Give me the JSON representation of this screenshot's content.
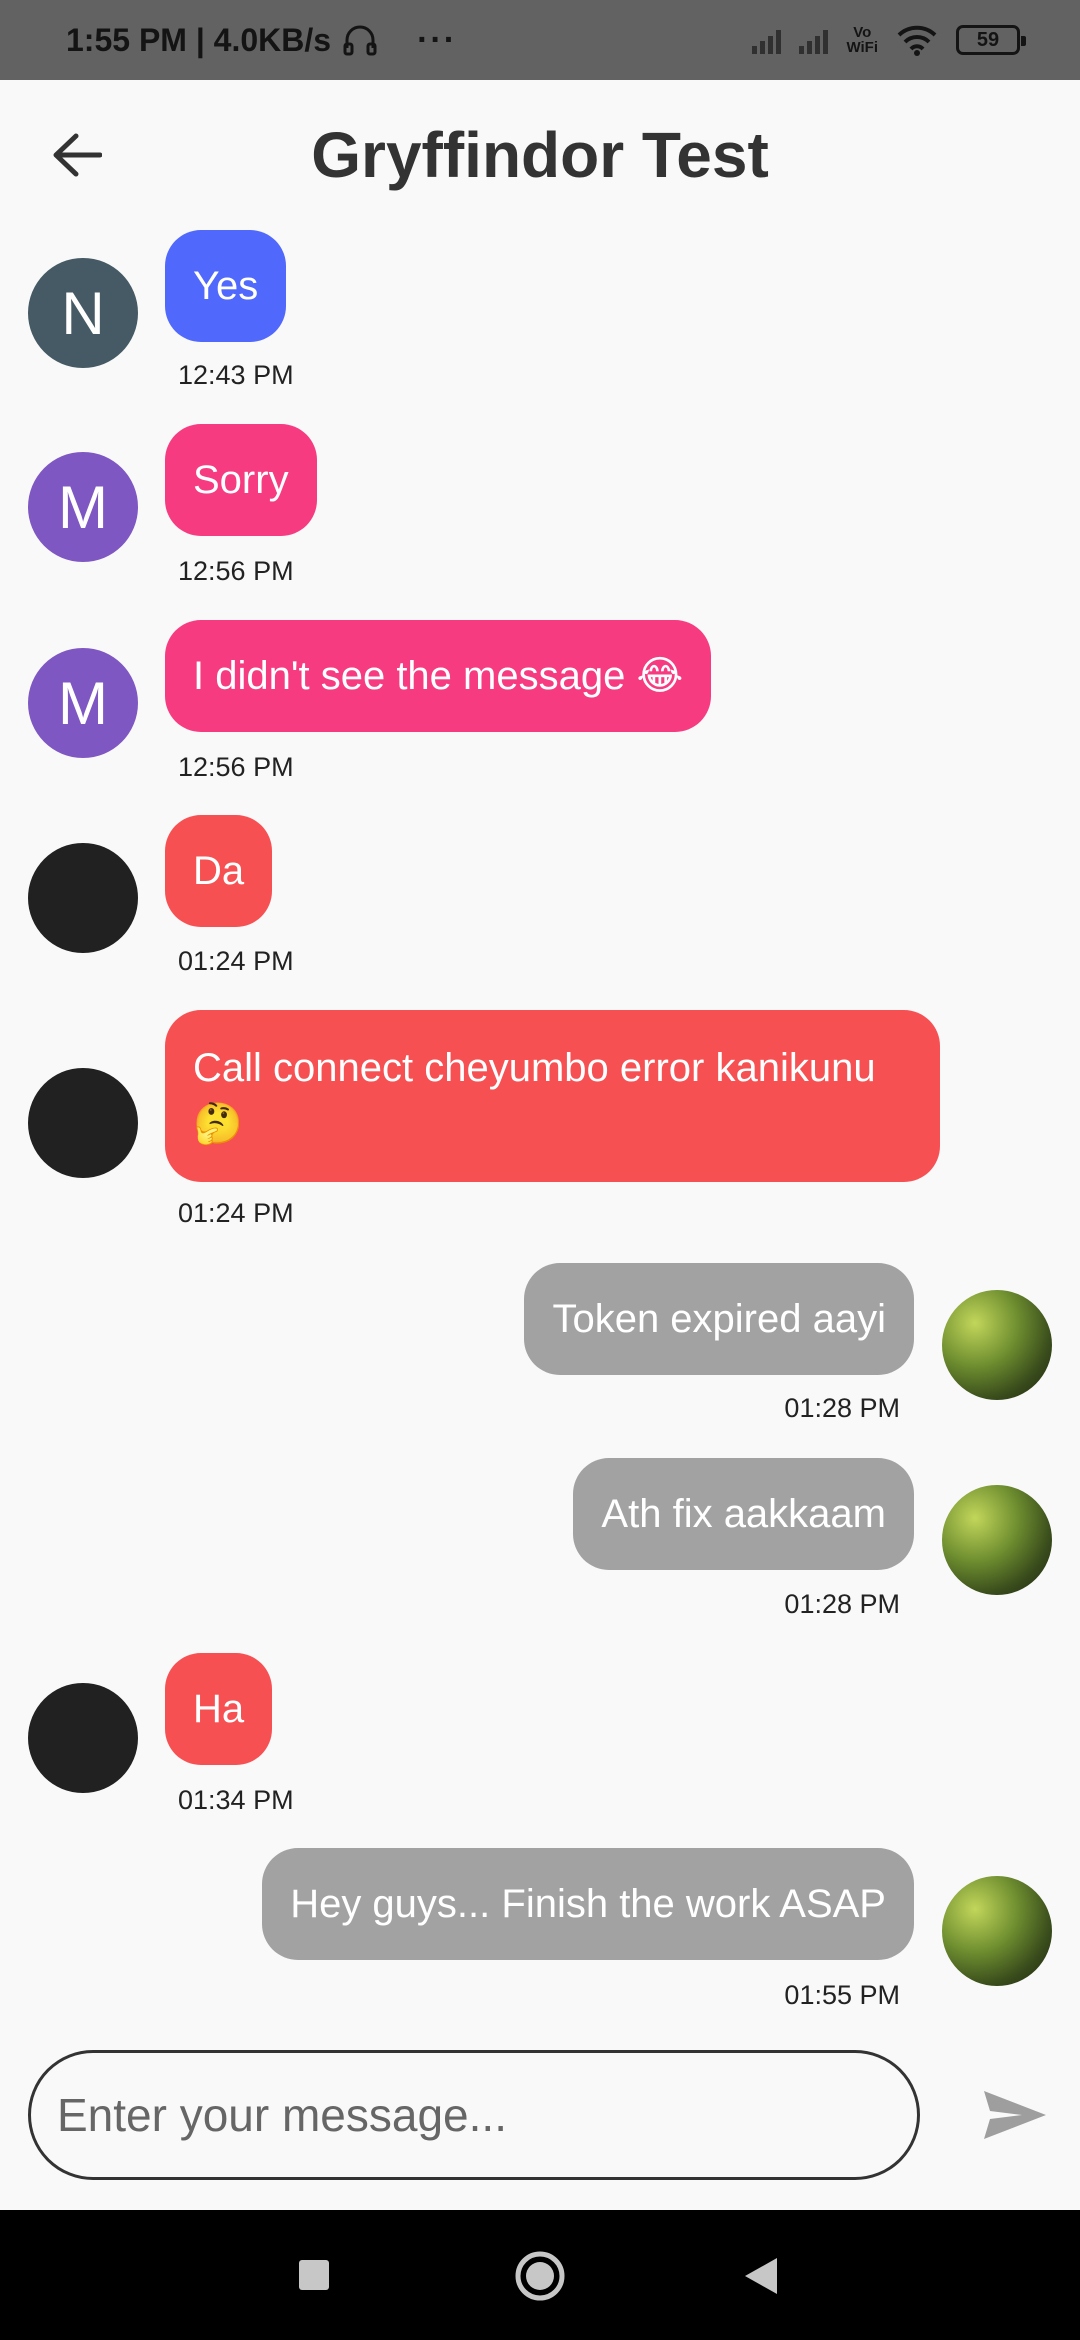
{
  "status_bar": {
    "time_speed": "1:55 PM | 4.0KB/s",
    "more": "···",
    "vowifi_top": "Vo",
    "vowifi_bottom": "WiFi",
    "battery": "59"
  },
  "header": {
    "title": "Gryffindor Test"
  },
  "messages": [
    {
      "avatar_letter": "N",
      "text": "Yes",
      "time": "12:43 PM"
    },
    {
      "avatar_letter": "M",
      "text": "Sorry",
      "time": "12:56 PM"
    },
    {
      "avatar_letter": "M",
      "text": "I didn't see the message 😂",
      "time": "12:56 PM"
    },
    {
      "avatar_letter": "",
      "text": "Da",
      "time": "01:24 PM"
    },
    {
      "avatar_letter": "",
      "text": "Call connect cheyumbo error kanikunu🤔",
      "time": "01:24 PM"
    },
    {
      "text": "Token expired aayi",
      "time": "01:28 PM"
    },
    {
      "text": "Ath fix aakkaam",
      "time": "01:28 PM"
    },
    {
      "avatar_letter": "",
      "text": "Ha",
      "time": "01:34 PM"
    },
    {
      "text": "Hey guys... Finish the work ASAP",
      "time": "01:55 PM"
    }
  ],
  "composer": {
    "placeholder": "Enter your message..."
  },
  "colors": {
    "blue_bubble": "#5068fb",
    "pink_bubble": "#f63b81",
    "red_bubble": "#f75053",
    "self_bubble": "#a2a2a2",
    "avatar_n": "#455a64",
    "avatar_m": "#7e57c2",
    "avatar_dark": "#212121"
  },
  "icons": [
    "back-arrow-icon",
    "send-icon",
    "square-nav-icon",
    "home-nav-icon",
    "back-nav-icon",
    "wifi-icon",
    "headphones-icon",
    "signal-icon"
  ]
}
